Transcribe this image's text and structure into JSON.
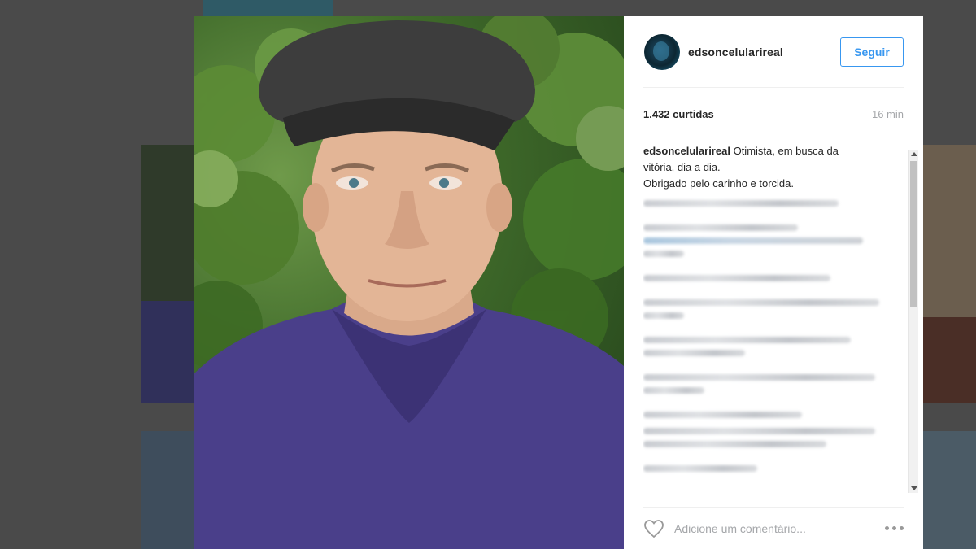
{
  "post": {
    "username": "edsoncelularireal",
    "follow_label": "Seguir",
    "likes": "1.432 curtidas",
    "time": "16 min",
    "caption": {
      "username": "edsoncelularireal",
      "line1": "Otimista, em busca da",
      "line2": "vitória, dia a dia.",
      "line3": "Obrigado pelo carinho e torcida."
    },
    "comment_placeholder": "Adicione um comentário..."
  },
  "icons": {
    "like": "heart-icon",
    "options": "more-options-icon",
    "scroll_up": "scroll-up-arrow-icon",
    "scroll_down": "scroll-down-arrow-icon"
  },
  "colors": {
    "accent": "#3897f0",
    "text": "#262626",
    "muted": "#a5a7aa",
    "backdrop": "#4a4a4a"
  }
}
